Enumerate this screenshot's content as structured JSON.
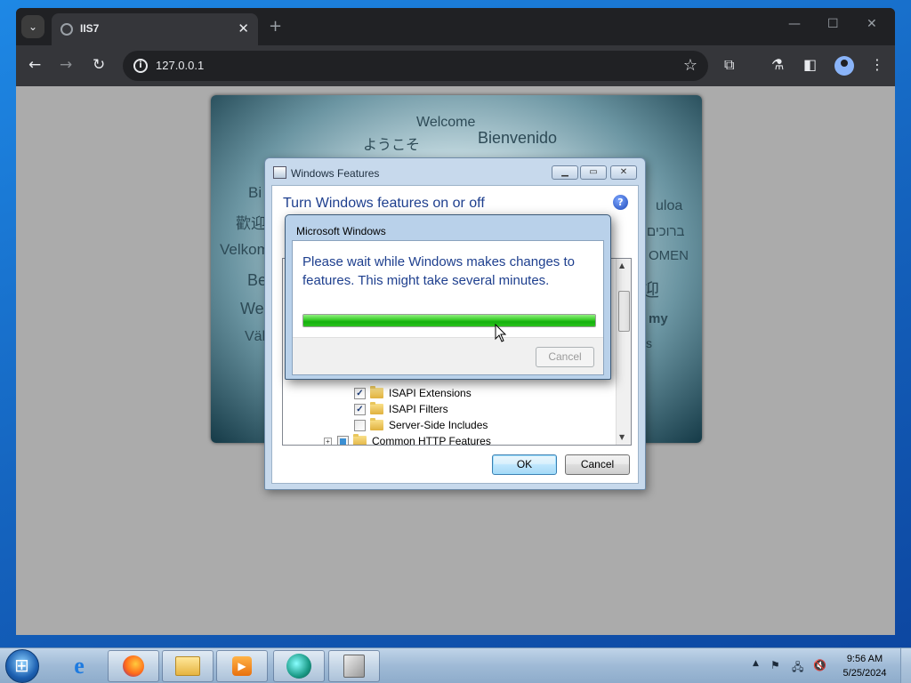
{
  "browser": {
    "tab_title": "IIS7",
    "url": "127.0.0.1",
    "new_tab_symbol": "+",
    "tab_close_symbol": "✕"
  },
  "iis_splash": {
    "words": [
      "Welcome",
      "ようこそ",
      "Bienvenido",
      "Bi",
      "歡迎",
      "Velkom",
      "Be",
      "We",
      "Väl",
      "uloa",
      "ברוכים",
      "OMEN",
      "迎",
      "my",
      "s"
    ]
  },
  "windows_features": {
    "title": "Windows Features",
    "heading": "Turn Windows features on or off",
    "help_symbol": "?",
    "tree_items": [
      {
        "label": "ISAPI Extensions",
        "checked": "✓"
      },
      {
        "label": "ISAPI Filters",
        "checked": "✓"
      },
      {
        "label": "Server-Side Includes",
        "checked": ""
      },
      {
        "label": "Common HTTP Features",
        "checked": "partial",
        "expander": "+"
      }
    ],
    "ok_label": "OK",
    "cancel_label": "Cancel"
  },
  "progress_dialog": {
    "title": "Microsoft Windows",
    "message": "Please wait while Windows makes changes to features. This might take several minutes.",
    "progress_percent": 100,
    "cancel_label": "Cancel"
  },
  "taskbar": {
    "clock_time": "9:56 AM",
    "clock_date": "5/25/2024",
    "apps": [
      "internet-explorer",
      "firefox",
      "file-explorer",
      "media-player",
      "chrome-like",
      "iis-manager"
    ]
  }
}
